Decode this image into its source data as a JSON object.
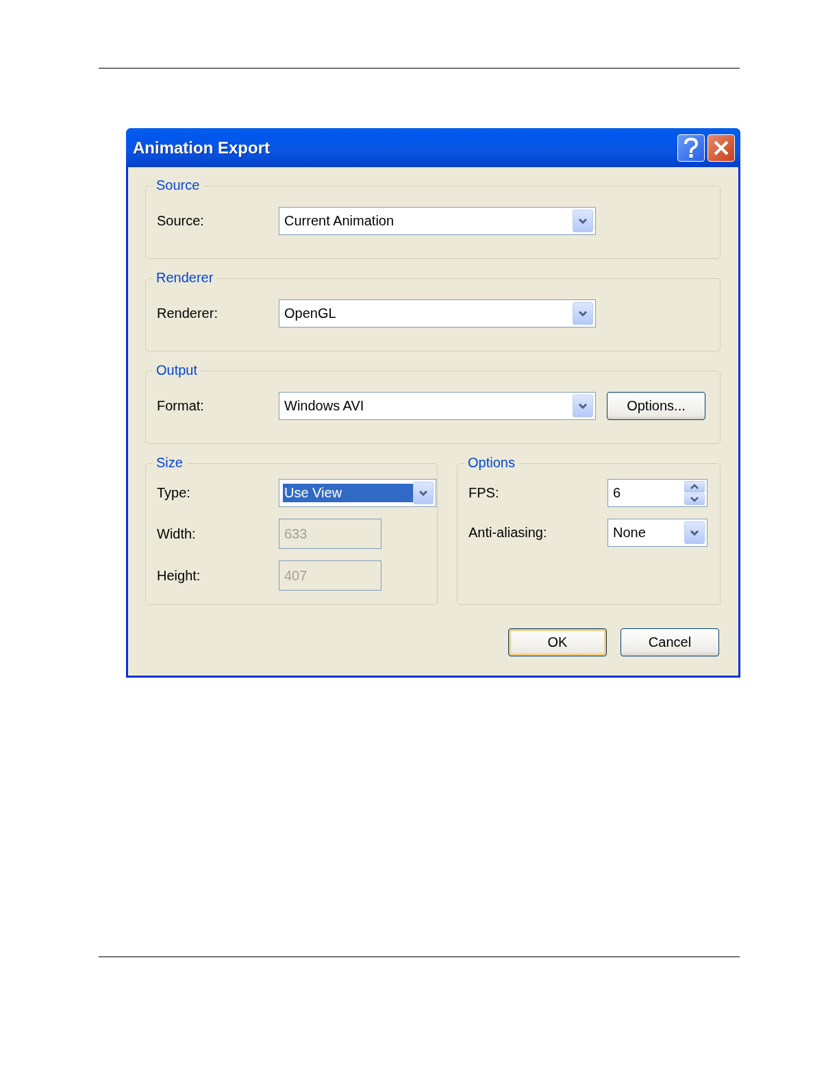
{
  "window": {
    "title": "Animation Export",
    "controls": [
      {
        "kind": "help"
      },
      {
        "kind": "close"
      }
    ]
  },
  "groups": [
    {
      "title": "Source",
      "kind": "full",
      "fields": [
        {
          "label": "Source:",
          "kind": "dropdown",
          "value": "Current Animation",
          "highlighted": false,
          "disabled": false
        }
      ]
    },
    {
      "title": "Renderer",
      "kind": "full",
      "fields": [
        {
          "label": "Renderer:",
          "kind": "dropdown",
          "value": "OpenGL",
          "highlighted": false,
          "disabled": false
        }
      ]
    },
    {
      "title": "Output",
      "kind": "full",
      "fields": [
        {
          "label": "Format:",
          "kind": "dropdown",
          "value": "Windows AVI",
          "highlighted": false,
          "disabled": false
        }
      ],
      "button": "Options..."
    },
    {
      "title": "Size",
      "kind": "half",
      "fields": [
        {
          "label": "Type:",
          "kind": "dropdown",
          "value": "Use View",
          "highlighted": true,
          "disabled": false
        },
        {
          "label": "Width:",
          "kind": "text",
          "value": "633",
          "highlighted": false,
          "disabled": true
        },
        {
          "label": "Height:",
          "kind": "text",
          "value": "407",
          "highlighted": false,
          "disabled": true
        }
      ]
    },
    {
      "title": "Options",
      "kind": "half",
      "fields": [
        {
          "label": "FPS:",
          "kind": "spinner",
          "value": "6",
          "highlighted": false,
          "disabled": false
        },
        {
          "label": "Anti-aliasing:",
          "kind": "dropdown",
          "value": "None",
          "highlighted": false,
          "disabled": false
        }
      ]
    }
  ],
  "buttons": [
    {
      "label": "OK",
      "default": true
    },
    {
      "label": "Cancel",
      "default": false
    }
  ]
}
